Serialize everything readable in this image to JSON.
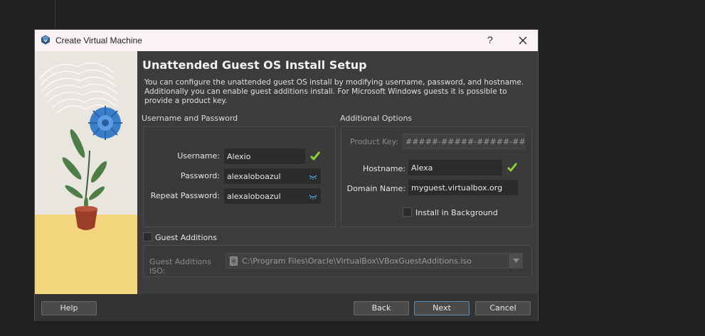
{
  "window": {
    "title": "Create Virtual Machine",
    "help_button": "?"
  },
  "page": {
    "heading": "Unattended Guest OS Install Setup",
    "description": "You can configure the unattended guest OS install by modifying username, password, and hostname. Additionally you can enable guest additions install. For Microsoft Windows guests it is possible to provide a product key."
  },
  "credentials": {
    "section_label": "Username and Password",
    "username_label": "Username:",
    "username_value": "Alexio",
    "password_label": "Password:",
    "password_value": "alexaloboazul",
    "repeat_label": "Repeat Password:",
    "repeat_value": "alexaloboazul"
  },
  "options": {
    "section_label": "Additional Options",
    "product_key_label": "Product Key:",
    "product_key_placeholder": "#####-#####-#####-#####-#####",
    "hostname_label": "Hostname:",
    "hostname_value": "Alexa",
    "domain_label": "Domain Name:",
    "domain_value": "myguest.virtualbox.org",
    "background_label": "Install in Background"
  },
  "guest_additions": {
    "checkbox_label": "Guest Additions",
    "iso_label": "Guest Additions ISO:",
    "iso_path": "C:\\Program Files\\Oracle\\VirtualBox\\VBoxGuestAdditions.iso"
  },
  "footer": {
    "help": "Help",
    "back": "Back",
    "next": "Next",
    "cancel": "Cancel"
  },
  "colors": {
    "accent": "#5b8fb9",
    "ok_check": "#8bd13a",
    "eye": "#4aa3df"
  }
}
